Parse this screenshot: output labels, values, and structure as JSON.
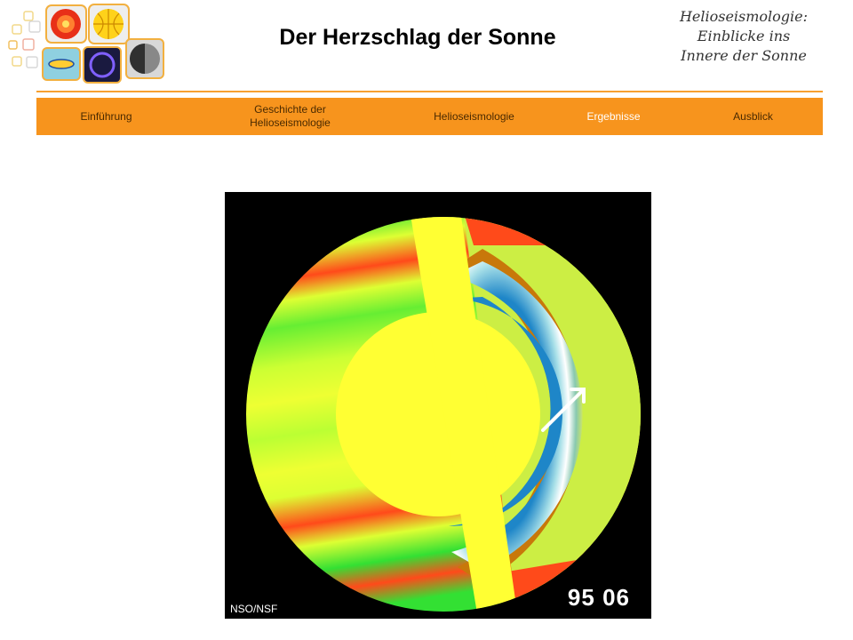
{
  "header": {
    "page_title": "Der Herzschlag der Sonne",
    "site_title_lines": [
      "Helioseismologie:",
      "Einblicke ins",
      "Innere der Sonne"
    ]
  },
  "nav": {
    "items": [
      {
        "label": "Einführung",
        "active": false
      },
      {
        "label": "Geschichte der Helioseismologie",
        "active": false
      },
      {
        "label": "Helioseismologie",
        "active": false
      },
      {
        "label": "Ergebnisse",
        "active": true
      },
      {
        "label": "Ausblick",
        "active": false
      }
    ]
  },
  "figure": {
    "credit": "NSO/NSF",
    "timestamp": "95 06"
  },
  "colors": {
    "nav_bg": "#f7941d",
    "accent_line": "#f7a030",
    "active_text": "#ffffff",
    "band_red": "#ff3b1a",
    "band_green": "#33e033",
    "band_yellow": "#ffff33",
    "band_blue": "#1e86c8",
    "band_brown": "#c8780a"
  }
}
